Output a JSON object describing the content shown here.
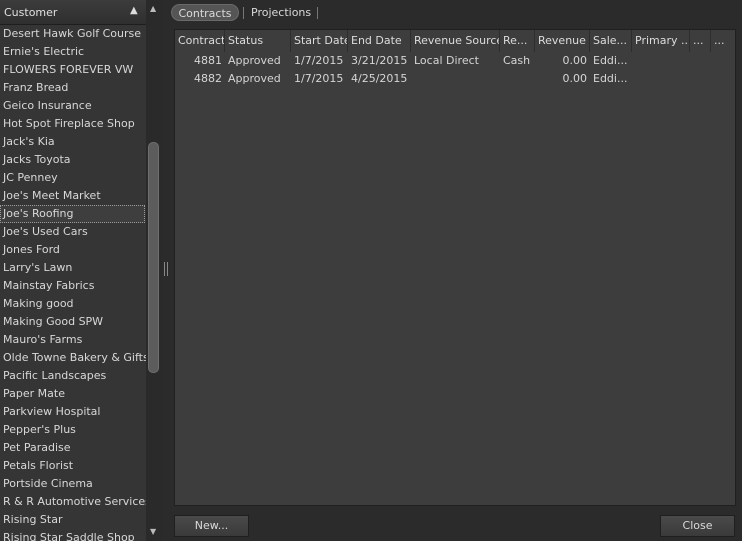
{
  "customer_panel": {
    "header": "Customer",
    "sort_indicator": "▲",
    "items": [
      "Desert Hawk Golf Course",
      "Ernie's Electric",
      "FLOWERS FOREVER  VW",
      "Franz Bread",
      "Geico Insurance",
      "Hot Spot Fireplace Shop",
      "Jack's Kia",
      "Jacks Toyota",
      "JC Penney",
      "Joe's Meet Market",
      "Joe's Roofing",
      "Joe's Used Cars",
      "Jones Ford",
      "Larry's Lawn",
      "Mainstay Fabrics",
      "Making good",
      "Making Good SPW",
      "Mauro's Farms",
      "Olde Towne Bakery & Gifts",
      "Pacific Landscapes",
      "Paper Mate",
      "Parkview Hospital",
      "Pepper's Plus",
      "Pet Paradise",
      "Petals Florist",
      "Portside Cinema",
      "R & R Automotive Services",
      "Rising Star",
      "Rising Star Saddle Shop"
    ],
    "selected": "Joe's Roofing",
    "scroll_up": "▲",
    "scroll_down": "▼"
  },
  "tabs": [
    {
      "label": "Contracts",
      "active": true
    },
    {
      "label": "Projections",
      "active": false
    }
  ],
  "table": {
    "columns": [
      "Contract",
      "Status",
      "Start Date",
      "End Date",
      "Revenue Source",
      "Re...",
      "Revenue",
      "Sale...",
      "Primary ...",
      "...",
      "..."
    ],
    "rows": [
      [
        "4881",
        "Approved",
        "1/7/2015",
        "3/21/2015",
        "Local Direct",
        "Cash",
        "0.00",
        "Eddi..."
      ],
      [
        "4882",
        "Approved",
        "1/7/2015",
        "4/25/2015",
        "",
        "",
        "0.00",
        "Eddi..."
      ]
    ]
  },
  "buttons": {
    "new": "New...",
    "close": "Close"
  },
  "colors": {
    "background": "#2b2b2b",
    "panel": "#353535",
    "table_bg": "#3d3d3d",
    "text": "#d4d4d4",
    "tab_active": "#555555"
  }
}
